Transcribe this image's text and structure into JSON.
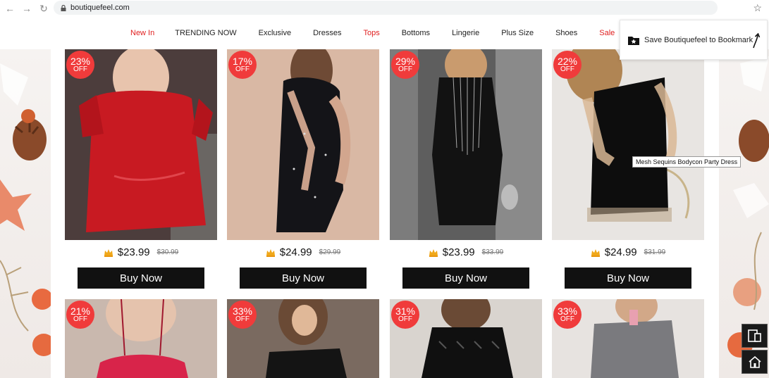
{
  "browser": {
    "url": "boutiquefeel.com"
  },
  "menu": {
    "items": [
      {
        "label": "New In",
        "color": "#e02020"
      },
      {
        "label": "TRENDING NOW",
        "color": "#222222"
      },
      {
        "label": "Exclusive",
        "color": "#222222"
      },
      {
        "label": "Dresses",
        "color": "#222222"
      },
      {
        "label": "Tops",
        "color": "#e02020"
      },
      {
        "label": "Bottoms",
        "color": "#222222"
      },
      {
        "label": "Lingerie",
        "color": "#222222"
      },
      {
        "label": "Plus Size",
        "color": "#222222"
      },
      {
        "label": "Shoes",
        "color": "#222222"
      },
      {
        "label": "Sale",
        "color": "#e02020"
      }
    ]
  },
  "bookmark": {
    "label": "Save Boutiquefeel to Bookmark"
  },
  "tooltip": {
    "text": "Mesh Sequins Bodycon Party Dress"
  },
  "products_row1": [
    {
      "discount": "23%",
      "off": "OFF",
      "price": "$23.99",
      "old_price": "$30.99",
      "buy": "Buy Now",
      "dress_color": "#c81a22",
      "bg": "#5a4a48"
    },
    {
      "discount": "17%",
      "off": "OFF",
      "price": "$24.99",
      "old_price": "$29.99",
      "buy": "Buy Now",
      "dress_color": "#141418",
      "bg": "#d8b9a6"
    },
    {
      "discount": "29%",
      "off": "OFF",
      "price": "$23.99",
      "old_price": "$33.99",
      "buy": "Buy Now",
      "dress_color": "#121212",
      "bg": "#6b6b6b"
    },
    {
      "discount": "22%",
      "off": "OFF",
      "price": "$24.99",
      "old_price": "$31.99",
      "buy": "Buy Now",
      "dress_color": "#0d0d0d",
      "bg": "#e9e6e4"
    }
  ],
  "products_row2": [
    {
      "discount": "21%",
      "off": "OFF",
      "dress_color": "#d8244a",
      "bg": "#c9b8ae"
    },
    {
      "discount": "33%",
      "off": "OFF",
      "dress_color": "#141414",
      "bg": "#8a7a70"
    },
    {
      "discount": "31%",
      "off": "OFF",
      "dress_color": "#101010",
      "bg": "#d9d4cf"
    },
    {
      "discount": "33%",
      "off": "OFF",
      "dress_color": "#7a7a7e",
      "bg": "#e7e3e0"
    }
  ]
}
